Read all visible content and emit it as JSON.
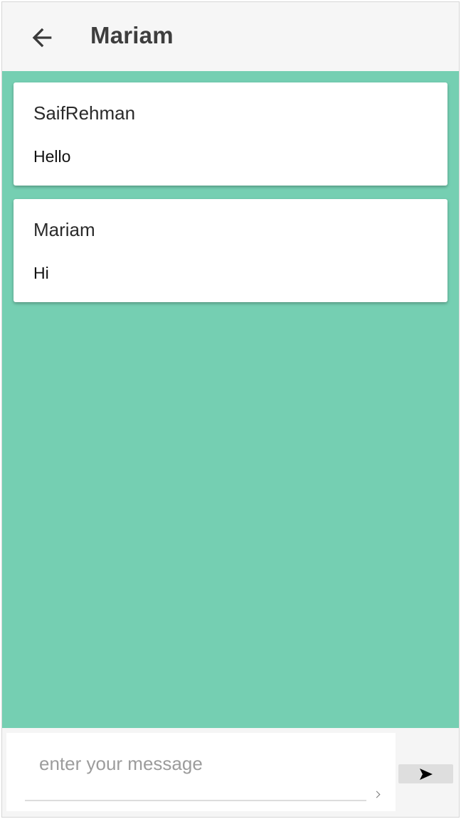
{
  "header": {
    "title": "Mariam",
    "back_icon": "arrow-left-icon"
  },
  "colors": {
    "chat_background": "#75cfb2",
    "card_background": "#ffffff",
    "header_background": "#f6f6f6"
  },
  "messages": [
    {
      "sender": "SaifRehman",
      "text": "Hello"
    },
    {
      "sender": "Mariam",
      "text": "Hi"
    }
  ],
  "composer": {
    "placeholder": "enter your message",
    "value": "",
    "send_icon": "send-icon"
  }
}
